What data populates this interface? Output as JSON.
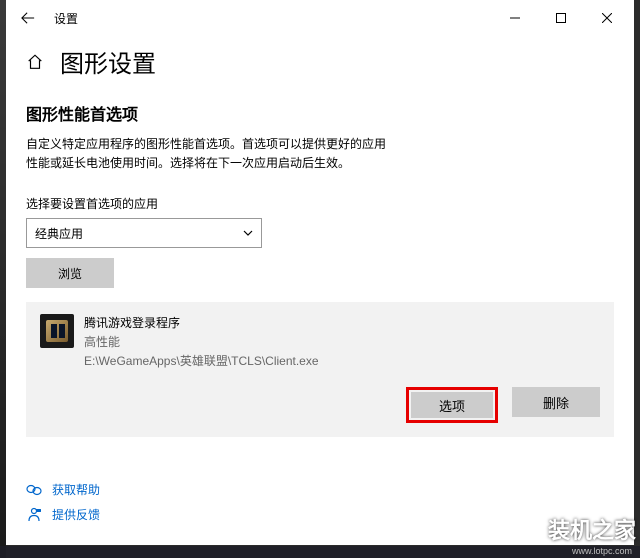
{
  "titlebar": {
    "title": "设置"
  },
  "page": {
    "title": "图形设置"
  },
  "section": {
    "heading": "图形性能首选项",
    "description": "自定义特定应用程序的图形性能首选项。首选项可以提供更好的应用性能或延长电池使用时间。选择将在下一次应用启动后生效。"
  },
  "selector": {
    "label": "选择要设置首选项的应用",
    "value": "经典应用",
    "browse": "浏览"
  },
  "app": {
    "name": "腾讯游戏登录程序",
    "perf": "高性能",
    "path": "E:\\WeGameApps\\英雄联盟\\TCLS\\Client.exe",
    "options": "选项",
    "remove": "删除"
  },
  "footer": {
    "help": "获取帮助",
    "feedback": "提供反馈"
  },
  "watermark": {
    "text": "装机之家",
    "sub": "www.lotpc.com"
  }
}
